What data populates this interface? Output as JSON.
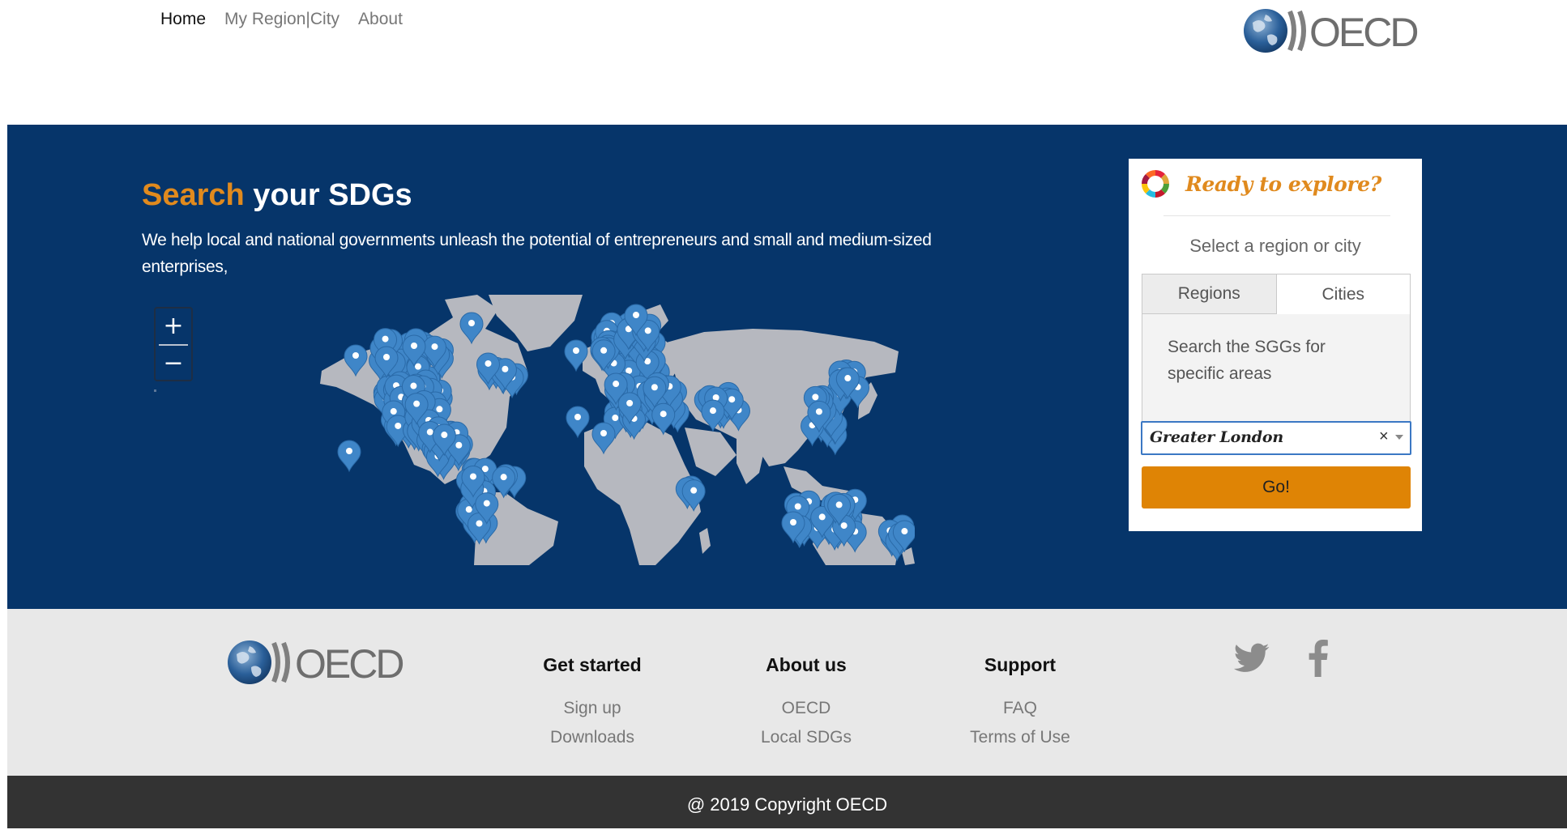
{
  "nav": {
    "items": [
      {
        "label": "Home",
        "active": true
      },
      {
        "label": "My Region|City",
        "active": false
      },
      {
        "label": "About",
        "active": false
      }
    ]
  },
  "brand": {
    "logo_text": "OECD",
    "logo_icon": "oecd-globe-icon"
  },
  "hero": {
    "title_accent": "Search",
    "title_rest": " your SDGs",
    "description": "We help local and national governments unleash the potential of entrepreneurs and small and medium-sized enterprises,",
    "zoom_in_label": "+",
    "zoom_out_label": "−",
    "map_icon": "world-map-markers"
  },
  "panel": {
    "icon": "sdg-wheel-icon",
    "title": "Ready to explore?",
    "subtitle": "Select a region or city",
    "tabs": [
      {
        "label": "Regions",
        "active": false
      },
      {
        "label": "Cities",
        "active": true
      }
    ],
    "tab_text": "Search the SGGs for specific areas",
    "select_value": "Greater London",
    "clear_symbol": "×",
    "go_label": "Go!"
  },
  "footer": {
    "columns": [
      {
        "heading": "Get started",
        "links": [
          "Sign up",
          "Downloads"
        ]
      },
      {
        "heading": "About us",
        "links": [
          "OECD",
          "Local SDGs"
        ]
      },
      {
        "heading": "Support",
        "links": [
          "FAQ",
          "Terms of Use"
        ]
      }
    ],
    "social": [
      "twitter-icon",
      "facebook-icon"
    ],
    "copyright": "@ 2019 Copyright OECD"
  },
  "colors": {
    "hero_bg": "#06356a",
    "accent": "#e08a1e",
    "go_button": "#df8405",
    "footer_bg": "#e8e8e8",
    "copyright_bg": "#333333",
    "marker": "#3f86c8"
  }
}
